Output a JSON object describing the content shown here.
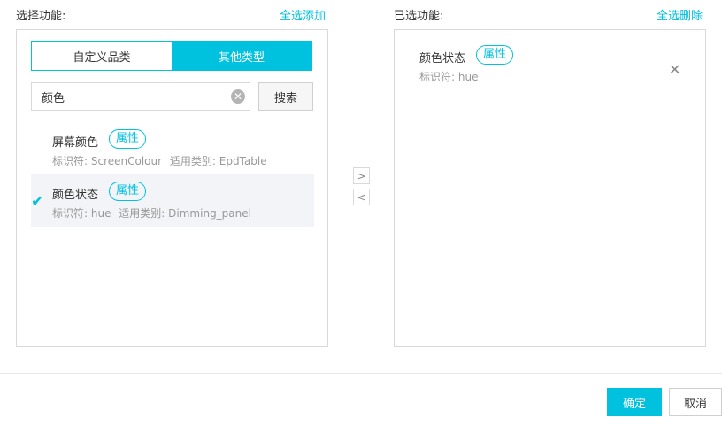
{
  "left_header": {
    "title": "选择功能:",
    "select_all": "全选添加"
  },
  "right_header": {
    "title": "已选功能:",
    "remove_all": "全选删除"
  },
  "tabs": [
    {
      "label": "自定义品类",
      "active": false
    },
    {
      "label": "其他类型",
      "active": true
    }
  ],
  "search": {
    "value": "颜色",
    "clear_icon": "clear-circle-icon",
    "button_label": "搜索"
  },
  "available_items": [
    {
      "name": "屏幕颜色",
      "tag": "属性",
      "id_label": "标识符:",
      "id_value": "ScreenColour",
      "type_label": "适用类别:",
      "type_value": "EpdTable",
      "selected": false
    },
    {
      "name": "颜色状态",
      "tag": "属性",
      "id_label": "标识符:",
      "id_value": "hue",
      "type_label": "适用类别:",
      "type_value": "Dimming_panel",
      "selected": true
    }
  ],
  "transfer": {
    "add_icon": "chevron-right-icon",
    "remove_icon": "chevron-left-icon"
  },
  "selected_items": [
    {
      "name": "颜色状态",
      "tag": "属性",
      "id_label": "标识符:",
      "id_value": "hue"
    }
  ],
  "footer": {
    "confirm_label": "确定",
    "cancel_label": "取消"
  },
  "colors": {
    "accent": "#00c1de",
    "border": "#d9d9d9",
    "selected_bg": "#f2f4f7",
    "meta_text": "#999999"
  }
}
